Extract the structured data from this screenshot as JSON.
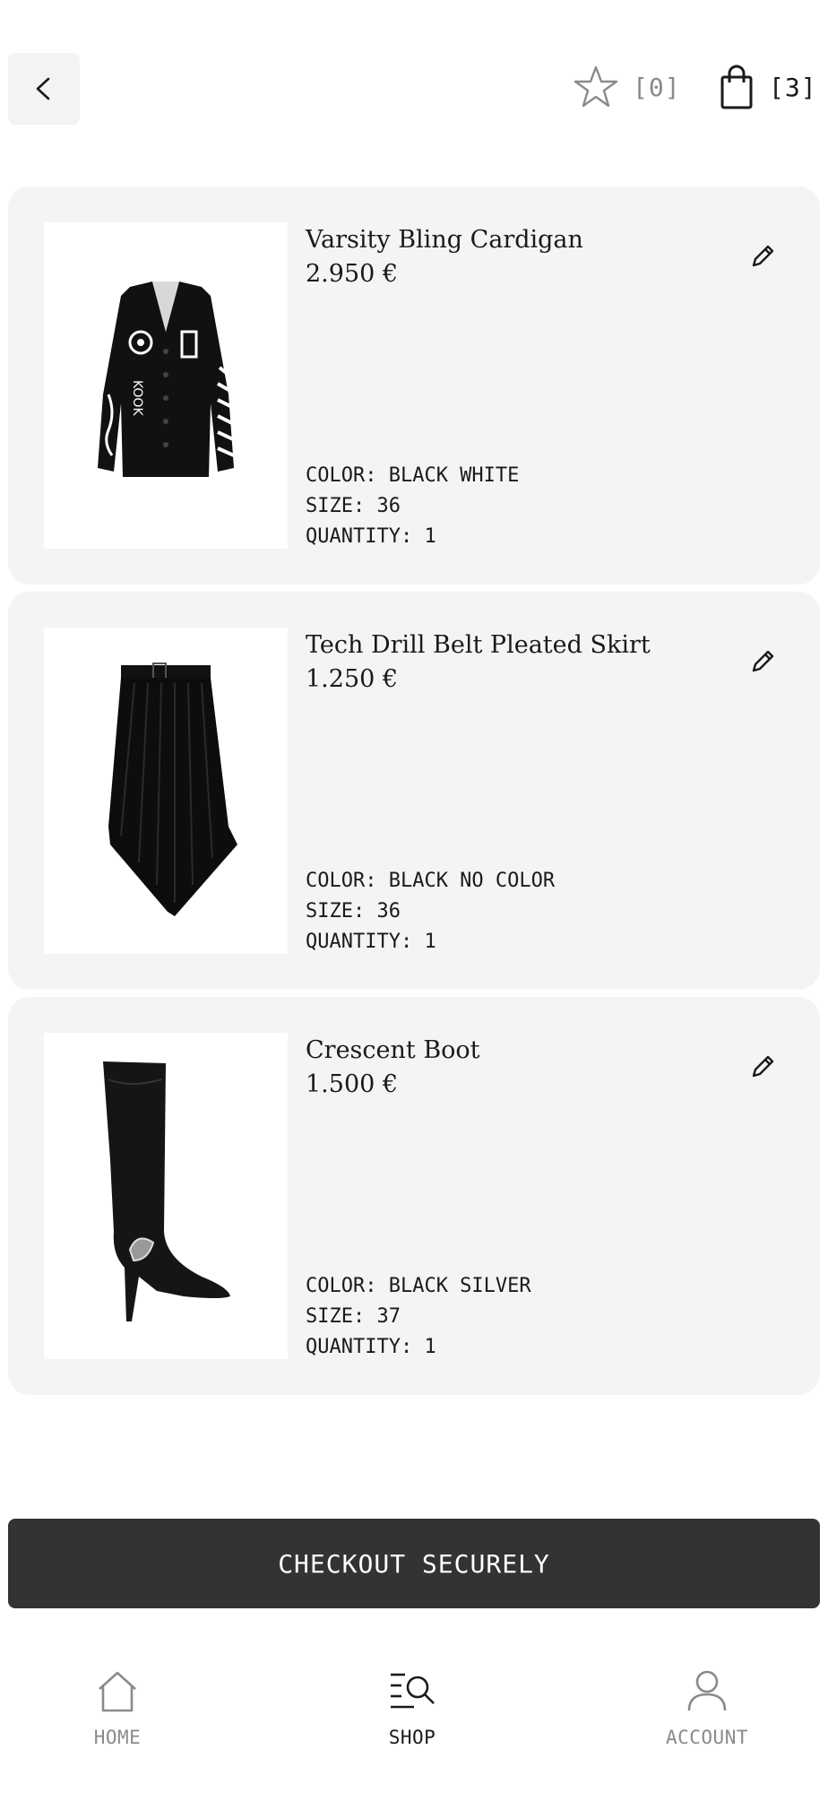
{
  "header": {
    "back_icon": "chevron-left-icon",
    "wishlist_icon": "star-outline-icon",
    "wishlist_count": "[0]",
    "bag_icon": "shopping-bag-icon",
    "bag_count": "[3]"
  },
  "cart": {
    "items": [
      {
        "name": "Varsity Bling Cardigan",
        "price": "2.950 €",
        "color": "COLOR: BLACK WHITE",
        "size": "SIZE: 36",
        "quantity": "QUANTITY: 1",
        "image": "black-cardigan-image"
      },
      {
        "name": "Tech Drill Belt Pleated Skirt",
        "price": "1.250 €",
        "color": "COLOR: BLACK NO COLOR",
        "size": "SIZE: 36",
        "quantity": "QUANTITY: 1",
        "image": "black-pleated-skirt-image"
      },
      {
        "name": "Crescent Boot",
        "price": "1.500 €",
        "color": "COLOR: BLACK SILVER",
        "size": "SIZE: 37",
        "quantity": "QUANTITY: 1",
        "image": "black-boot-image"
      }
    ],
    "edit_icon": "pencil-icon"
  },
  "checkout": {
    "label": "CHECKOUT SECURELY"
  },
  "bottom_nav": {
    "items": [
      {
        "label": "HOME",
        "icon": "home-icon",
        "active": false
      },
      {
        "label": "SHOP",
        "icon": "shop-search-icon",
        "active": true
      },
      {
        "label": "ACCOUNT",
        "icon": "user-icon",
        "active": false
      }
    ]
  },
  "colors": {
    "card_background": "#f4f4f4",
    "checkout_background": "#333333",
    "inactive_text": "#8a8a8a",
    "active_text": "#1a1a1a"
  }
}
